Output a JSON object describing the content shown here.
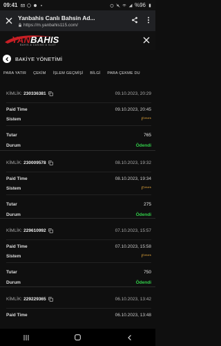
{
  "statusbar": {
    "time": "09:41",
    "battery": "%96"
  },
  "browser": {
    "title": "Yanbahis Canlı Bahsin Ad...",
    "url": "https://m.yanbahis115.com/"
  },
  "site": {
    "logo_text_first": "YAN",
    "logo_text_rest": "BAHIS",
    "logo_tag": "BAHIS & CASINO & SLOT"
  },
  "page": {
    "title": "BAKİYE YÖNETİMİ"
  },
  "tabs": [
    "PARA YATIR",
    "ÇEKİM",
    "İŞLEM GEÇMİŞİ",
    "BİLGİ",
    "PARA ÇEKME DU"
  ],
  "labels": {
    "id": "KİMLİK:",
    "paid_time": "Paid Time",
    "system": "Sistem",
    "amount": "Tutar",
    "status": "Durum"
  },
  "transactions": [
    {
      "id": "230336381",
      "date": "09.10.2023, 20:29",
      "paid_time": "09.10.2023, 20:45",
      "system": "F****",
      "amount": "765",
      "status": "Ödendi"
    },
    {
      "id": "230009578",
      "date": "08.10.2023, 19:32",
      "paid_time": "08.10.2023, 19:34",
      "system": "F****",
      "amount": "275",
      "status": "Ödendi"
    },
    {
      "id": "229610992",
      "date": "07.10.2023, 15:57",
      "paid_time": "07.10.2023, 15:58",
      "system": "F****",
      "amount": "750",
      "status": "Ödendi"
    },
    {
      "id": "229229365",
      "date": "06.10.2023, 13:42",
      "paid_time": "06.10.2023, 13:48",
      "system": "",
      "amount": "",
      "status": ""
    }
  ],
  "colors": {
    "accent_gold": "#e2a53a",
    "status_green": "#32d04a",
    "brand_red": "#c81f25"
  },
  "icons": {
    "back": "arrow-left-icon",
    "copy": "copy-icon",
    "close": "close-icon",
    "share": "share-icon",
    "menu": "more-vertical-icon"
  }
}
